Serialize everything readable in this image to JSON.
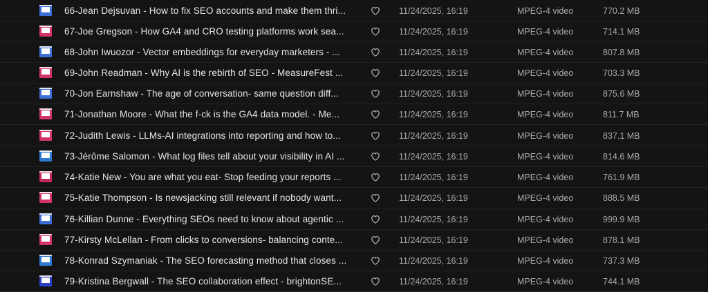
{
  "rows": [
    {
      "name": "66-Jean Dejsuvan - How to fix SEO accounts and make them thri...",
      "date": "11/24/2025, 16:19",
      "kind": "MPEG-4 video",
      "size": "770.2 MB",
      "thumb_color": "#3b6fd6"
    },
    {
      "name": "67-Joe Gregson - How GA4 and CRO testing platforms work sea...",
      "date": "11/24/2025, 16:19",
      "kind": "MPEG-4 video",
      "size": "714.1 MB",
      "thumb_color": "#d2336b"
    },
    {
      "name": "68-John Iwuozor - Vector embeddings for everyday marketers - ...",
      "date": "11/24/2025, 16:19",
      "kind": "MPEG-4 video",
      "size": "807.8 MB",
      "thumb_color": "#3b6fd6"
    },
    {
      "name": "69-John Readman - Why AI is the rebirth of SEO - MeasureFest ...",
      "date": "11/24/2025, 16:19",
      "kind": "MPEG-4 video",
      "size": "703.3 MB",
      "thumb_color": "#d2336b"
    },
    {
      "name": "70-Jon Earnshaw - The age of conversation- same question diff...",
      "date": "11/24/2025, 16:19",
      "kind": "MPEG-4 video",
      "size": "875.6 MB",
      "thumb_color": "#3b6fd6"
    },
    {
      "name": "71-Jonathan Moore - What the f-ck is the GA4 data model. - Me...",
      "date": "11/24/2025, 16:19",
      "kind": "MPEG-4 video",
      "size": "811.7 MB",
      "thumb_color": "#d2336b"
    },
    {
      "name": "72-Judith Lewis - LLMs-AI integrations into reporting and how to...",
      "date": "11/24/2025, 16:19",
      "kind": "MPEG-4 video",
      "size": "837.1 MB",
      "thumb_color": "#d2336b"
    },
    {
      "name": "73-Jérôme Salomon - What log files tell about your visibility in AI ...",
      "date": "11/24/2025, 16:19",
      "kind": "MPEG-4 video",
      "size": "814.6 MB",
      "thumb_color": "#2f7ad0"
    },
    {
      "name": "74-Katie New - You are what you eat- Stop feeding your reports ...",
      "date": "11/24/2025, 16:19",
      "kind": "MPEG-4 video",
      "size": "761.9 MB",
      "thumb_color": "#c42a5a"
    },
    {
      "name": "75-Katie Thompson - Is newsjacking still relevant if nobody want...",
      "date": "11/24/2025, 16:19",
      "kind": "MPEG-4 video",
      "size": "888.5 MB",
      "thumb_color": "#d2336b"
    },
    {
      "name": "76-Killian Dunne - Everything SEOs need to know about agentic ...",
      "date": "11/24/2025, 16:19",
      "kind": "MPEG-4 video",
      "size": "999.9 MB",
      "thumb_color": "#3b6fd6"
    },
    {
      "name": "77-Kirsty McLellan - From clicks to conversions- balancing conte...",
      "date": "11/24/2025, 16:19",
      "kind": "MPEG-4 video",
      "size": "878.1 MB",
      "thumb_color": "#d2336b"
    },
    {
      "name": "78-Konrad Szymaniak - The SEO forecasting method that closes ...",
      "date": "11/24/2025, 16:19",
      "kind": "MPEG-4 video",
      "size": "737.3 MB",
      "thumb_color": "#2f7ad0"
    },
    {
      "name": "79-Kristina Bergwall - The SEO collaboration effect - brightonSE...",
      "date": "11/24/2025, 16:19",
      "kind": "MPEG-4 video",
      "size": "744.1 MB",
      "thumb_color": "#2b3fc4"
    }
  ],
  "icons": {
    "favorite": "heart-outline-icon",
    "file": "video-thumbnail-icon"
  }
}
